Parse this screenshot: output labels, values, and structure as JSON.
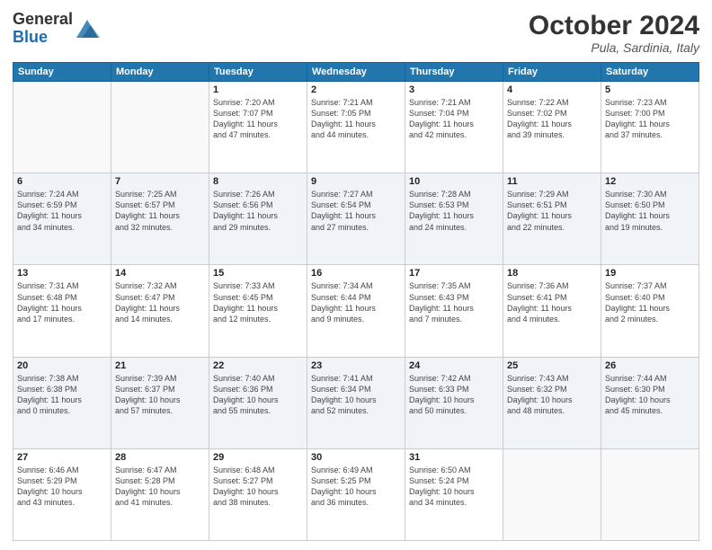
{
  "logo": {
    "general": "General",
    "blue": "Blue"
  },
  "title": "October 2024",
  "location": "Pula, Sardinia, Italy",
  "days_header": [
    "Sunday",
    "Monday",
    "Tuesday",
    "Wednesday",
    "Thursday",
    "Friday",
    "Saturday"
  ],
  "weeks": [
    {
      "shade": false,
      "days": [
        {
          "num": "",
          "info": ""
        },
        {
          "num": "",
          "info": ""
        },
        {
          "num": "1",
          "info": "Sunrise: 7:20 AM\nSunset: 7:07 PM\nDaylight: 11 hours\nand 47 minutes."
        },
        {
          "num": "2",
          "info": "Sunrise: 7:21 AM\nSunset: 7:05 PM\nDaylight: 11 hours\nand 44 minutes."
        },
        {
          "num": "3",
          "info": "Sunrise: 7:21 AM\nSunset: 7:04 PM\nDaylight: 11 hours\nand 42 minutes."
        },
        {
          "num": "4",
          "info": "Sunrise: 7:22 AM\nSunset: 7:02 PM\nDaylight: 11 hours\nand 39 minutes."
        },
        {
          "num": "5",
          "info": "Sunrise: 7:23 AM\nSunset: 7:00 PM\nDaylight: 11 hours\nand 37 minutes."
        }
      ]
    },
    {
      "shade": true,
      "days": [
        {
          "num": "6",
          "info": "Sunrise: 7:24 AM\nSunset: 6:59 PM\nDaylight: 11 hours\nand 34 minutes."
        },
        {
          "num": "7",
          "info": "Sunrise: 7:25 AM\nSunset: 6:57 PM\nDaylight: 11 hours\nand 32 minutes."
        },
        {
          "num": "8",
          "info": "Sunrise: 7:26 AM\nSunset: 6:56 PM\nDaylight: 11 hours\nand 29 minutes."
        },
        {
          "num": "9",
          "info": "Sunrise: 7:27 AM\nSunset: 6:54 PM\nDaylight: 11 hours\nand 27 minutes."
        },
        {
          "num": "10",
          "info": "Sunrise: 7:28 AM\nSunset: 6:53 PM\nDaylight: 11 hours\nand 24 minutes."
        },
        {
          "num": "11",
          "info": "Sunrise: 7:29 AM\nSunset: 6:51 PM\nDaylight: 11 hours\nand 22 minutes."
        },
        {
          "num": "12",
          "info": "Sunrise: 7:30 AM\nSunset: 6:50 PM\nDaylight: 11 hours\nand 19 minutes."
        }
      ]
    },
    {
      "shade": false,
      "days": [
        {
          "num": "13",
          "info": "Sunrise: 7:31 AM\nSunset: 6:48 PM\nDaylight: 11 hours\nand 17 minutes."
        },
        {
          "num": "14",
          "info": "Sunrise: 7:32 AM\nSunset: 6:47 PM\nDaylight: 11 hours\nand 14 minutes."
        },
        {
          "num": "15",
          "info": "Sunrise: 7:33 AM\nSunset: 6:45 PM\nDaylight: 11 hours\nand 12 minutes."
        },
        {
          "num": "16",
          "info": "Sunrise: 7:34 AM\nSunset: 6:44 PM\nDaylight: 11 hours\nand 9 minutes."
        },
        {
          "num": "17",
          "info": "Sunrise: 7:35 AM\nSunset: 6:43 PM\nDaylight: 11 hours\nand 7 minutes."
        },
        {
          "num": "18",
          "info": "Sunrise: 7:36 AM\nSunset: 6:41 PM\nDaylight: 11 hours\nand 4 minutes."
        },
        {
          "num": "19",
          "info": "Sunrise: 7:37 AM\nSunset: 6:40 PM\nDaylight: 11 hours\nand 2 minutes."
        }
      ]
    },
    {
      "shade": true,
      "days": [
        {
          "num": "20",
          "info": "Sunrise: 7:38 AM\nSunset: 6:38 PM\nDaylight: 11 hours\nand 0 minutes."
        },
        {
          "num": "21",
          "info": "Sunrise: 7:39 AM\nSunset: 6:37 PM\nDaylight: 10 hours\nand 57 minutes."
        },
        {
          "num": "22",
          "info": "Sunrise: 7:40 AM\nSunset: 6:36 PM\nDaylight: 10 hours\nand 55 minutes."
        },
        {
          "num": "23",
          "info": "Sunrise: 7:41 AM\nSunset: 6:34 PM\nDaylight: 10 hours\nand 52 minutes."
        },
        {
          "num": "24",
          "info": "Sunrise: 7:42 AM\nSunset: 6:33 PM\nDaylight: 10 hours\nand 50 minutes."
        },
        {
          "num": "25",
          "info": "Sunrise: 7:43 AM\nSunset: 6:32 PM\nDaylight: 10 hours\nand 48 minutes."
        },
        {
          "num": "26",
          "info": "Sunrise: 7:44 AM\nSunset: 6:30 PM\nDaylight: 10 hours\nand 45 minutes."
        }
      ]
    },
    {
      "shade": false,
      "days": [
        {
          "num": "27",
          "info": "Sunrise: 6:46 AM\nSunset: 5:29 PM\nDaylight: 10 hours\nand 43 minutes."
        },
        {
          "num": "28",
          "info": "Sunrise: 6:47 AM\nSunset: 5:28 PM\nDaylight: 10 hours\nand 41 minutes."
        },
        {
          "num": "29",
          "info": "Sunrise: 6:48 AM\nSunset: 5:27 PM\nDaylight: 10 hours\nand 38 minutes."
        },
        {
          "num": "30",
          "info": "Sunrise: 6:49 AM\nSunset: 5:25 PM\nDaylight: 10 hours\nand 36 minutes."
        },
        {
          "num": "31",
          "info": "Sunrise: 6:50 AM\nSunset: 5:24 PM\nDaylight: 10 hours\nand 34 minutes."
        },
        {
          "num": "",
          "info": ""
        },
        {
          "num": "",
          "info": ""
        }
      ]
    }
  ]
}
